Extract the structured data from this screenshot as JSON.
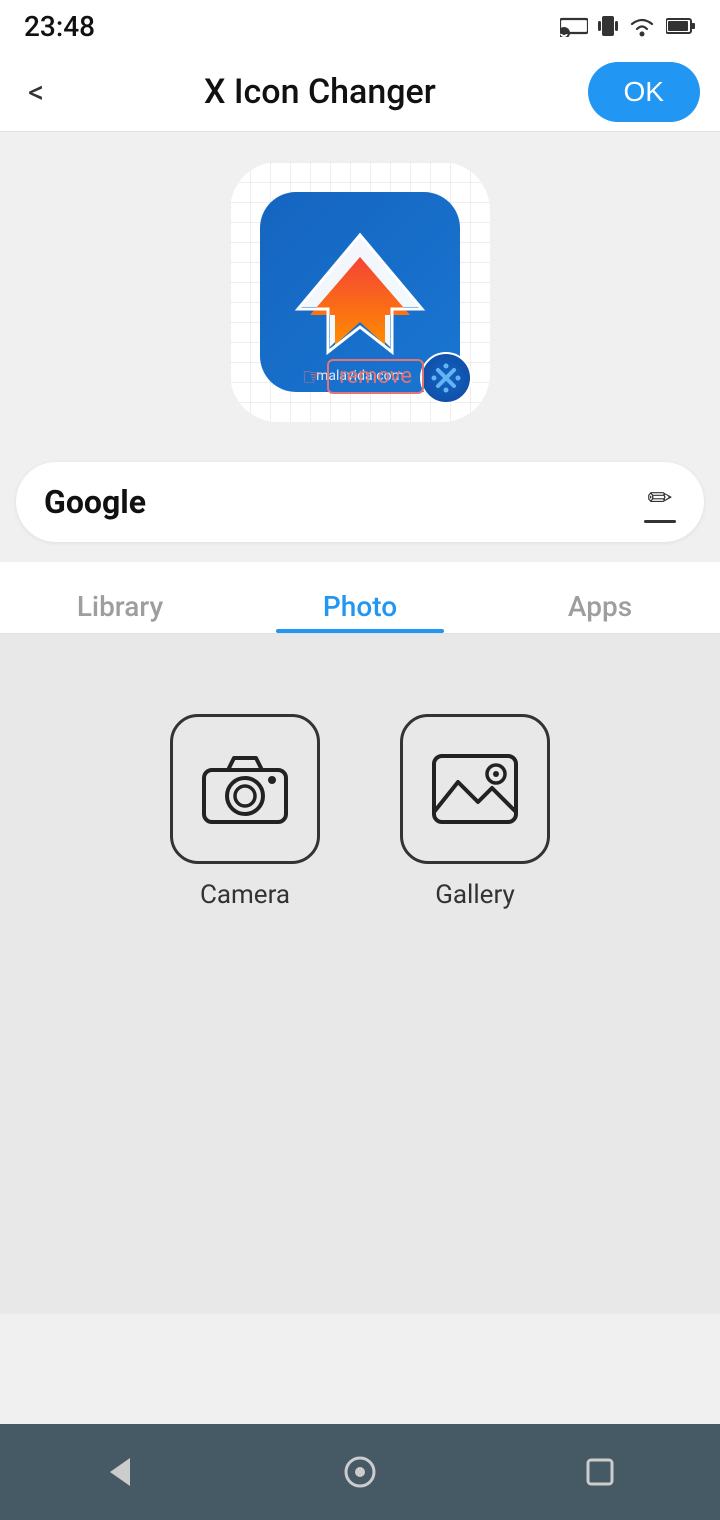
{
  "statusBar": {
    "time": "23:48",
    "cloudIcon": "☁",
    "castIcon": "cast",
    "vibrateIcon": "vibrate",
    "wifiIcon": "wifi",
    "batteryIcon": "battery"
  },
  "appBar": {
    "backLabel": "<",
    "title": "X Icon Changer",
    "okLabel": "OK"
  },
  "iconSection": {
    "watermark": "malavida.com",
    "removeLabel": "remove"
  },
  "appNameBar": {
    "name": "Google",
    "editAriaLabel": "Edit"
  },
  "tabs": [
    {
      "id": "library",
      "label": "Library",
      "active": false
    },
    {
      "id": "photo",
      "label": "Photo",
      "active": true
    },
    {
      "id": "apps",
      "label": "Apps",
      "active": false
    }
  ],
  "photoOptions": [
    {
      "id": "camera",
      "label": "Camera"
    },
    {
      "id": "gallery",
      "label": "Gallery"
    }
  ],
  "bottomNav": {
    "backLabel": "◀",
    "homeLabel": "⬤",
    "recentLabel": "▣"
  }
}
